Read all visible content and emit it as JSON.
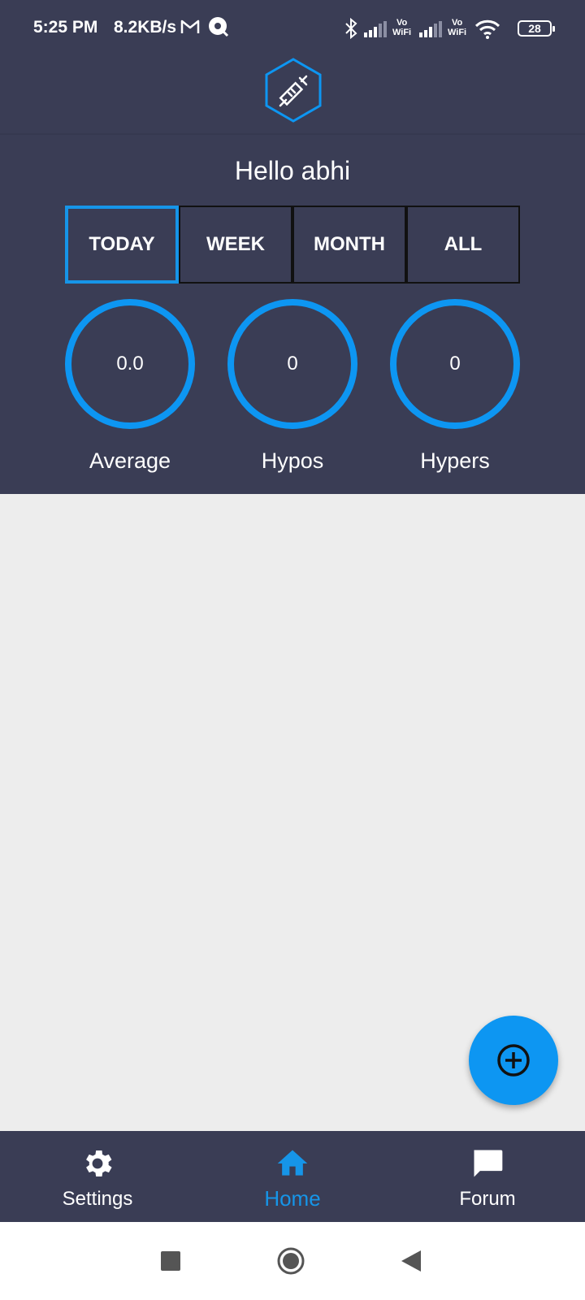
{
  "status_bar": {
    "time": "5:25 PM",
    "speed": "8.2KB/s",
    "battery": "28",
    "icons": [
      "gmail-icon",
      "notification-icon",
      "bluetooth-icon",
      "signal-icon",
      "vowifi-icon",
      "signal-icon",
      "vowifi-icon",
      "wifi-icon",
      "battery-icon"
    ],
    "vowifi_top": "Vo",
    "vowifi_bottom": "WiFi"
  },
  "app": {
    "logo": "syringe-hexagon-icon",
    "greeting": "Hello abhi"
  },
  "tabs": [
    {
      "label": "TODAY",
      "active": true
    },
    {
      "label": "WEEK",
      "active": false
    },
    {
      "label": "MONTH",
      "active": false
    },
    {
      "label": "ALL",
      "active": false
    }
  ],
  "stats": [
    {
      "value": "0.0",
      "label": "Average"
    },
    {
      "value": "0",
      "label": "Hypos"
    },
    {
      "value": "0",
      "label": "Hypers"
    }
  ],
  "fab": {
    "icon": "add-circle-icon"
  },
  "bottom_nav": [
    {
      "label": "Settings",
      "icon": "gear-icon",
      "active": false
    },
    {
      "label": "Home",
      "icon": "home-icon",
      "active": true
    },
    {
      "label": "Forum",
      "icon": "chat-bubble-icon",
      "active": false
    }
  ],
  "colors": {
    "background": "#3a3d55",
    "accent": "#0d96f2",
    "content": "#ededed"
  }
}
